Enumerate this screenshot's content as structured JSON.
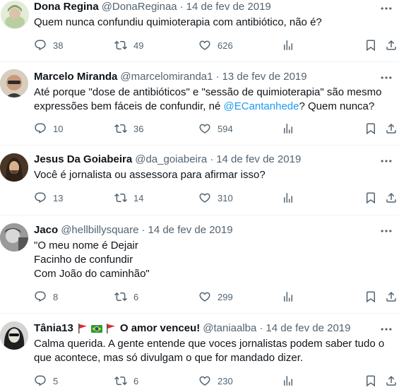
{
  "tweets": [
    {
      "name": "Dona Regina",
      "handle": "@DonaReginaa",
      "separator": "·",
      "date": "14 de fev de 2019",
      "lines": [
        "Quem nunca confundiu quimioterapia com antibiótico, não é?"
      ],
      "replies": "38",
      "retweets": "49",
      "likes": "626"
    },
    {
      "name": "Marcelo Miranda",
      "handle": "@marcelomiranda1",
      "separator": "·",
      "date": "13 de fev de 2019",
      "line1": "Até porque \"dose de antibióticos\" e \"sessão de quimioterapia\" são mesmo",
      "line2_pre": "expressões bem fáceis de confundir, né ",
      "mention": "@ECantanhede",
      "line2_post": "? Quem nunca?",
      "replies": "10",
      "retweets": "36",
      "likes": "594"
    },
    {
      "name": "Jesus Da Goiabeira",
      "handle": "@da_goiabeira",
      "separator": "·",
      "date": "14 de fev de 2019",
      "lines": [
        "Você é jornalista ou assessora para afirmar isso?"
      ],
      "replies": "13",
      "retweets": "14",
      "likes": "310"
    },
    {
      "name": "Jaco",
      "handle": "@hellbillysquare",
      "separator": "·",
      "date": "14 de fev de 2019",
      "lines": [
        "\"O meu nome é Dejair",
        "Facinho de confundir",
        "Com João do caminhão\""
      ],
      "replies": "8",
      "retweets": "6",
      "likes": "299"
    },
    {
      "name": "Tânia13",
      "name_suffix": "O amor venceu!",
      "handle": "@taniaalba",
      "separator": "·",
      "date": "14 de fev de 2019",
      "lines": [
        "Calma querida. A gente entende que voces jornalistas podem saber tudo o",
        "que acontece, mas só divulgam o que for mandado dizer."
      ],
      "replies": "5",
      "retweets": "6",
      "likes": "230"
    }
  ],
  "colors": {
    "text": "#0f1419",
    "muted": "#536471",
    "link": "#1d9bf0",
    "divider": "#eff3f4"
  },
  "icons": [
    "reply-icon",
    "retweet-icon",
    "like-icon",
    "views-icon",
    "bookmark-icon",
    "share-icon",
    "more-icon"
  ]
}
